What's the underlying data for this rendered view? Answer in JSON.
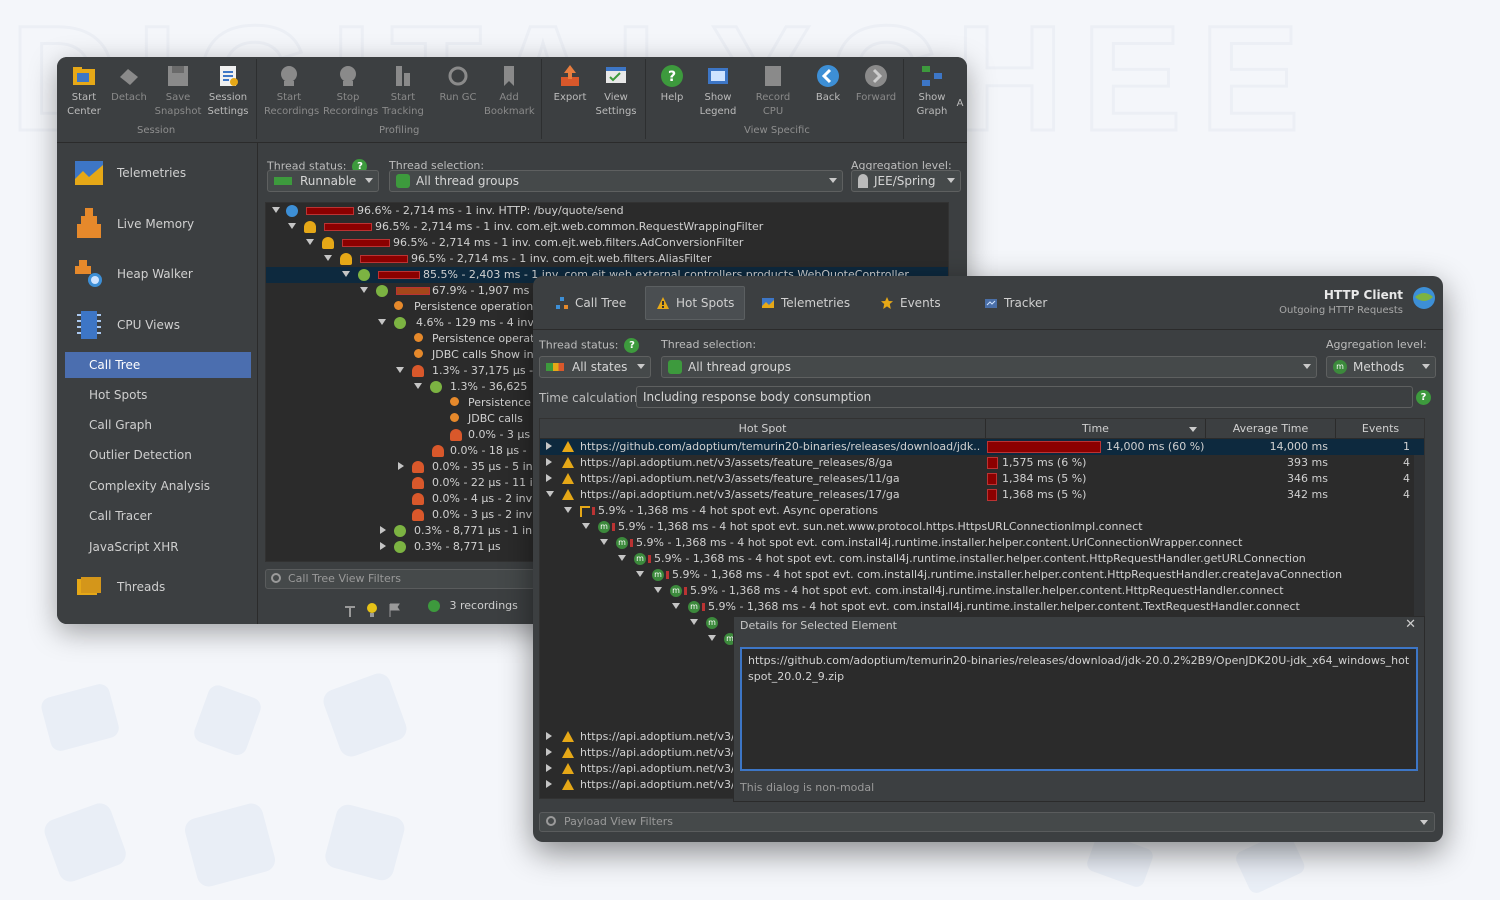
{
  "winA": {
    "toolbar": {
      "buttons": [
        {
          "label": "Start\nCenter",
          "icon": "folder-icon"
        },
        {
          "label": "Detach",
          "icon": "detach-icon"
        },
        {
          "label": "Save\nSnapshot",
          "icon": "save-icon"
        },
        {
          "label": "Session\nSettings",
          "icon": "settings-icon"
        },
        {
          "label": "Start\nRecordings",
          "icon": "record-icon"
        },
        {
          "label": "Stop\nRecordings",
          "icon": "stop-record-icon"
        },
        {
          "label": "Start\nTracking",
          "icon": "tracking-icon"
        },
        {
          "label": "Run GC",
          "icon": "gc-icon"
        },
        {
          "label": "Add\nBookmark",
          "icon": "bookmark-icon"
        },
        {
          "label": "Export",
          "icon": "export-icon"
        },
        {
          "label": "View\nSettings",
          "icon": "view-settings-icon"
        },
        {
          "label": "Help",
          "icon": "help-icon"
        },
        {
          "label": "Show\nLegend",
          "icon": "legend-icon"
        },
        {
          "label": "Record\nCPU",
          "icon": "cpu-icon"
        },
        {
          "label": "Back",
          "icon": "back-icon"
        },
        {
          "label": "Forward",
          "icon": "forward-icon"
        },
        {
          "label": "Show\nGraph",
          "icon": "graph-icon"
        }
      ],
      "groups": [
        "Session",
        "Profiling",
        "View Specific"
      ],
      "overflow": "A"
    },
    "sidebar": {
      "sections": [
        "Telemetries",
        "Live Memory",
        "Heap Walker",
        "CPU Views",
        "Threads"
      ],
      "cpu_items": [
        "Call Tree",
        "Hot Spots",
        "Call Graph",
        "Outlier Detection",
        "Complexity Analysis",
        "Call Tracer",
        "JavaScript XHR"
      ],
      "selected": "Call Tree"
    },
    "controls": {
      "thread_status_label": "Thread status:",
      "thread_status_value": "Runnable",
      "thread_selection_label": "Thread selection:",
      "thread_selection_value": "All thread groups",
      "aggregation_label": "Aggregation level:",
      "aggregation_value": "JEE/Spring"
    },
    "tree": [
      "96.6% - 2,714 ms - 1 inv. HTTP: /buy/quote/send",
      "96.5% - 2,714 ms - 1 inv. com.ejt.web.common.RequestWrappingFilter",
      "96.5% - 2,714 ms - 1 inv. com.ejt.web.filters.AdConversionFilter",
      "96.5% - 2,714 ms - 1 inv. com.ejt.web.filters.AliasFilter",
      "85.5% - 2,403 ms - 1 inv. com.ejt.web.external.controllers.products.WebQuoteController",
      "67.9% - 1,907 ms -",
      "Persistence operation",
      "4.6% - 129 ms - 4 inv",
      "Persistence operat",
      "JDBC calls Show in",
      "1.3% - 37,175 µs -",
      "1.3% - 36,625",
      "Persistence",
      "JDBC calls",
      "0.0% - 3 µs",
      "0.0% - 18 µs -",
      "0.0% - 35 µs - 5 in",
      "0.0% - 22 µs - 11 i",
      "0.0% - 4 µs - 2 inv",
      "0.0% - 3 µs - 2 inv",
      "0.3% - 8,771 µs - 1 in",
      "0.3% - 8,771 µs"
    ],
    "filter_placeholder": "Call Tree View Filters",
    "status": "3 recordings"
  },
  "winB": {
    "tabs": [
      "Call Tree",
      "Hot Spots",
      "Telemetries",
      "Events",
      "Tracker"
    ],
    "selected_tab": "Hot Spots",
    "probe_title": "HTTP Client",
    "probe_subtitle": "Outgoing HTTP Requests",
    "controls": {
      "thread_status_label": "Thread status:",
      "thread_status_value": "All states",
      "thread_selection_label": "Thread selection:",
      "thread_selection_value": "All thread groups",
      "aggregation_label": "Aggregation level:",
      "aggregation_value": "Methods",
      "time_calc_label": "Time calculation:",
      "time_calc_value": "Including response body consumption"
    },
    "columns": [
      "Hot Spot",
      "Time",
      "Average Time",
      "Events"
    ],
    "rows": [
      {
        "hot": "https://github.com/adoptium/temurin20-binaries/releases/download/jdk...",
        "time": "14,000 ms (60 %)",
        "pct": 0.6,
        "avg": "14,000 ms",
        "events": "1"
      },
      {
        "hot": "https://api.adoptium.net/v3/assets/feature_releases/8/ga",
        "time": "1,575 ms (6 %)",
        "pct": 0.06,
        "avg": "393 ms",
        "events": "4"
      },
      {
        "hot": "https://api.adoptium.net/v3/assets/feature_releases/11/ga",
        "time": "1,384 ms (5 %)",
        "pct": 0.05,
        "avg": "346 ms",
        "events": "4"
      },
      {
        "hot": "https://api.adoptium.net/v3/assets/feature_releases/17/ga",
        "time": "1,368 ms (5 %)",
        "pct": 0.05,
        "avg": "342 ms",
        "events": "4"
      }
    ],
    "subtree": [
      "5.9% - 1,368 ms - 4 hot spot evt. Async operations",
      "5.9% - 1,368 ms - 4 hot spot evt. sun.net.www.protocol.https.HttpsURLConnectionImpl.connect",
      "5.9% - 1,368 ms - 4 hot spot evt. com.install4j.runtime.installer.helper.content.UrlConnectionWrapper.connect",
      "5.9% - 1,368 ms - 4 hot spot evt. com.install4j.runtime.installer.helper.content.HttpRequestHandler.getURLConnection",
      "5.9% - 1,368 ms - 4 hot spot evt. com.install4j.runtime.installer.helper.content.HttpRequestHandler.createJavaConnection",
      "5.9% - 1,368 ms - 4 hot spot evt. com.install4j.runtime.installer.helper.content.HttpRequestHandler.connect",
      "5.9% - 1,368 ms - 4 hot spot evt. com.install4j.runtime.installer.helper.content.TextRequestHandler.connect"
    ],
    "bottom_rows": [
      "https://api.adoptium.net/v3/",
      "https://api.adoptium.net/v3/",
      "https://api.adoptium.net/v3/",
      "https://api.adoptium.net/v3/"
    ],
    "dialog": {
      "title": "Details for Selected Element",
      "content": "https://github.com/adoptium/temurin20-binaries/releases/download/jdk-20.0.2%2B9/OpenJDK20U-jdk_x64_windows_hotspot_20.0.2_9.zip",
      "footer": "This dialog is non-modal"
    },
    "filter_placeholder": "Payload View Filters"
  },
  "colors": {
    "accent": "#4b6eaf",
    "selection": "#0d293e",
    "bar": "#8b0000",
    "dark": "#3c3f41"
  }
}
